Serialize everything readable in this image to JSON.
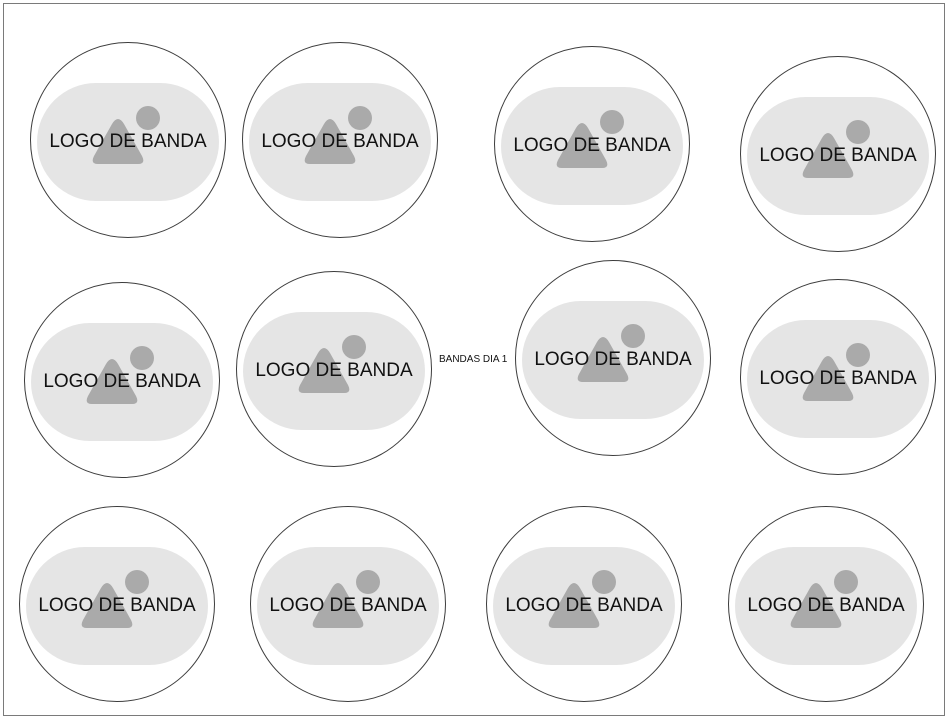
{
  "canvas_label": "BANDAS DIA 1",
  "logo_placeholder_text": "LOGO DE BANDA",
  "colors": {
    "frame_border": "#7a7a7a",
    "circle_border": "#3c3c3c",
    "logo_fill": "#e5e5e5",
    "icon_fill": "#aaaaaa"
  },
  "icons": {
    "placeholder": "image-placeholder-icon"
  },
  "bands": [
    {
      "label": "LOGO DE BANDA"
    },
    {
      "label": "LOGO DE BANDA"
    },
    {
      "label": "LOGO DE BANDA"
    },
    {
      "label": "LOGO DE BANDA"
    },
    {
      "label": "LOGO DE BANDA"
    },
    {
      "label": "LOGO DE BANDA"
    },
    {
      "label": "LOGO DE BANDA"
    },
    {
      "label": "LOGO DE BANDA"
    },
    {
      "label": "LOGO DE BANDA"
    },
    {
      "label": "LOGO DE BANDA"
    },
    {
      "label": "LOGO DE BANDA"
    },
    {
      "label": "LOGO DE BANDA"
    }
  ]
}
